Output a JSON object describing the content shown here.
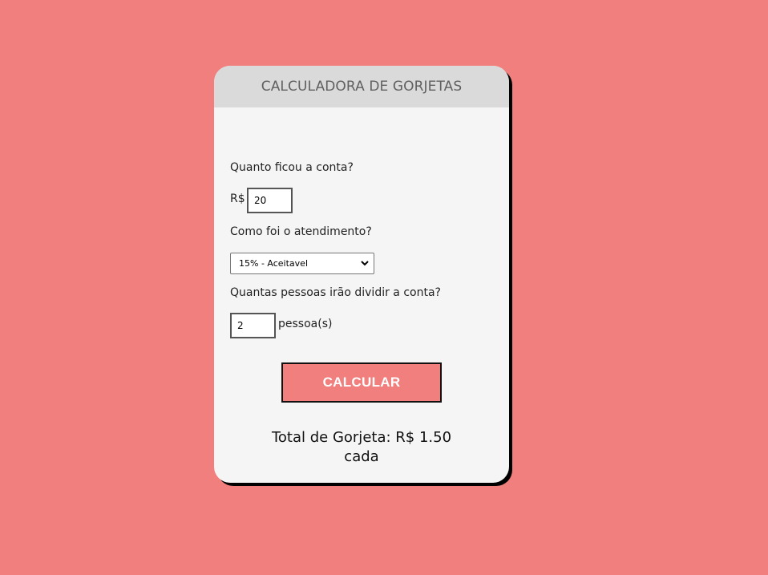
{
  "header": {
    "title": "CALCULADORA DE GORJETAS"
  },
  "bill": {
    "question": "Quanto ficou a conta?",
    "currency_prefix": "R$",
    "value": "20"
  },
  "service": {
    "question": "Como foi o atendimento?",
    "selected_option": "15% - Aceitavel"
  },
  "people": {
    "question": "Quantas pessoas irão dividir a conta?",
    "value": "2",
    "suffix": "pessoa(s)"
  },
  "actions": {
    "calculate_label": "CALCULAR"
  },
  "result": {
    "line1": "Total de Gorjeta: R$ 1.50",
    "line2": "cada"
  },
  "colors": {
    "background": "#f07f7d",
    "card": "#f5f5f5",
    "header": "#dadada",
    "button": "#f07f7d"
  }
}
